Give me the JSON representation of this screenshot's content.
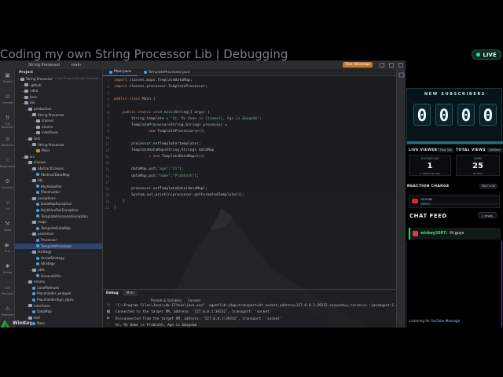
{
  "stream": {
    "title": "Coding my own String Processor Lib | Debugging",
    "live_label": "LIVE",
    "streamer_name": "WinKey"
  },
  "ide": {
    "titlebar": {
      "project": "String Processor",
      "branch": "main",
      "run_config": "TemplateProcessor.java",
      "trial_label": "Trial: Windows"
    },
    "left_strip": [
      {
        "icon": "project-icon",
        "label": "Project"
      },
      {
        "icon": "commit-icon",
        "label": "Commit"
      },
      {
        "icon": "pull-requests-icon",
        "label": "Pull Requests"
      },
      {
        "icon": "structure-icon",
        "label": "Structure"
      },
      {
        "icon": "bookmarks-icon",
        "label": "Bookmarks"
      },
      {
        "icon": "services-icon",
        "label": "Services"
      },
      {
        "icon": "git-icon",
        "label": "Git"
      },
      {
        "icon": "build-icon",
        "label": "Build"
      },
      {
        "icon": "run-icon",
        "label": "Run"
      },
      {
        "icon": "debug-icon",
        "label": "Debug"
      },
      {
        "icon": "terminal-icon",
        "label": "Terminal"
      },
      {
        "icon": "problems-icon",
        "label": "Problems"
      }
    ],
    "project_panel": {
      "header": "Project",
      "tree": [
        {
          "indent": 0,
          "kind": "folder",
          "label": "String Processor",
          "path": "C:\\My Projects\\String Processor"
        },
        {
          "indent": 1,
          "kind": "folder",
          "label": ".github"
        },
        {
          "indent": 1,
          "kind": "folder",
          "label": ".idea"
        },
        {
          "indent": 1,
          "kind": "folder",
          "label": "Java"
        },
        {
          "indent": 1,
          "kind": "folder",
          "label": "bin"
        },
        {
          "indent": 2,
          "kind": "folder",
          "label": "production"
        },
        {
          "indent": 3,
          "kind": "folder",
          "label": "String Processor"
        },
        {
          "indent": 4,
          "kind": "folder",
          "label": "classes"
        },
        {
          "indent": 4,
          "kind": "folder",
          "label": "enums"
        },
        {
          "indent": 4,
          "kind": "folder",
          "label": "interfaces"
        },
        {
          "indent": 2,
          "kind": "folder",
          "label": "test"
        },
        {
          "indent": 3,
          "kind": "folder",
          "label": "String Processor"
        },
        {
          "indent": 4,
          "kind": "file",
          "label": "Main"
        },
        {
          "indent": 1,
          "kind": "folder",
          "label": "src"
        },
        {
          "indent": 2,
          "kind": "folder",
          "label": "classes"
        },
        {
          "indent": 3,
          "kind": "folder",
          "label": "abstractClasses"
        },
        {
          "indent": 4,
          "kind": "class",
          "label": "AbstractDataMap"
        },
        {
          "indent": 3,
          "kind": "folder",
          "label": "dto"
        },
        {
          "indent": 4,
          "kind": "class",
          "label": "KeyValuePair"
        },
        {
          "indent": 4,
          "kind": "class",
          "label": "Placeholder"
        },
        {
          "indent": 3,
          "kind": "folder",
          "label": "exceptions"
        },
        {
          "indent": 4,
          "kind": "class",
          "label": "DataMapException"
        },
        {
          "indent": 4,
          "kind": "class",
          "label": "KeyValuePairException"
        },
        {
          "indent": 4,
          "kind": "class",
          "label": "TemplateProcessorException"
        },
        {
          "indent": 3,
          "kind": "folder",
          "label": "maps"
        },
        {
          "indent": 4,
          "kind": "class",
          "label": "TemplateDataMap"
        },
        {
          "indent": 3,
          "kind": "folder",
          "label": "processor"
        },
        {
          "indent": 4,
          "kind": "class",
          "label": "Processor"
        },
        {
          "indent": 4,
          "kind": "class",
          "label": "TemplateProcessor",
          "selected": true
        },
        {
          "indent": 3,
          "kind": "folder",
          "label": "strategy"
        },
        {
          "indent": 4,
          "kind": "class",
          "label": "ArrowStrategy"
        },
        {
          "indent": 4,
          "kind": "class",
          "label": "Strategy"
        },
        {
          "indent": 3,
          "kind": "folder",
          "label": "utils"
        },
        {
          "indent": 4,
          "kind": "class",
          "label": "GeneralUtils"
        },
        {
          "indent": 2,
          "kind": "folder",
          "label": "enums"
        },
        {
          "indent": 3,
          "kind": "class",
          "label": "CaseMethods"
        },
        {
          "indent": 3,
          "kind": "class",
          "label": "Placeholder_wrapper"
        },
        {
          "indent": 3,
          "kind": "class",
          "label": "PlaceholderSign_signs"
        },
        {
          "indent": 2,
          "kind": "folder",
          "label": "interfaces"
        },
        {
          "indent": 3,
          "kind": "class",
          "label": "DataMap"
        },
        {
          "indent": 2,
          "kind": "folder",
          "label": "test"
        },
        {
          "indent": 3,
          "kind": "class",
          "label": "Main"
        }
      ]
    },
    "editor": {
      "tabs": [
        {
          "label": "Main.java",
          "active": true
        },
        {
          "label": "TemplateProcessor.java",
          "active": false
        }
      ],
      "code": [
        {
          "n": "1",
          "segs": [
            {
              "c": "kw",
              "t": "import "
            },
            {
              "c": "txt",
              "t": "classes.maps.TemplateDataMap;"
            }
          ]
        },
        {
          "n": "2",
          "segs": [
            {
              "c": "kw",
              "t": "import "
            },
            {
              "c": "txt",
              "t": "classes.processor.TemplateProcessor;"
            }
          ]
        },
        {
          "n": "3",
          "segs": []
        },
        {
          "n": "4",
          "segs": [
            {
              "c": "kw",
              "t": "public class "
            },
            {
              "c": "txt",
              "t": "Main {"
            }
          ]
        },
        {
          "n": "5",
          "segs": []
        },
        {
          "n": "6",
          "segs": [
            {
              "c": "kw",
              "t": "    public static void "
            },
            {
              "c": "fn",
              "t": "main"
            },
            {
              "c": "txt",
              "t": "(String[] args) {"
            }
          ]
        },
        {
          "n": "7",
          "segs": [
            {
              "c": "txt",
              "t": "        String template = "
            },
            {
              "c": "str",
              "t": "\"Hi, My Name is {{name}}, Age is &&age&&\""
            },
            {
              "c": "txt",
              "t": ";"
            }
          ]
        },
        {
          "n": "8",
          "segs": [
            {
              "c": "txt",
              "t": "        TemplateProcessor<String,String> processor ="
            }
          ]
        },
        {
          "n": "9",
          "segs": [
            {
              "c": "kw",
              "t": "                new "
            },
            {
              "c": "txt",
              "t": "TemplateProcessor<>();"
            }
          ]
        },
        {
          "n": "10",
          "segs": []
        },
        {
          "n": "11",
          "segs": [
            {
              "c": "txt",
              "t": "        processor.setTemplate(template);"
            }
          ]
        },
        {
          "n": "12",
          "segs": [
            {
              "c": "txt",
              "t": "        TemplateDataMap<String,String> dataMap"
            }
          ]
        },
        {
          "n": "13",
          "segs": [
            {
              "c": "kw",
              "t": "                = new "
            },
            {
              "c": "txt",
              "t": "TemplateDataMap<>();"
            }
          ]
        },
        {
          "n": "14",
          "segs": []
        },
        {
          "n": "15",
          "segs": [
            {
              "c": "txt",
              "t": "        dataMap.put("
            },
            {
              "c": "str",
              "t": "\"age\""
            },
            {
              "c": "txt",
              "t": ","
            },
            {
              "c": "str",
              "t": "\"21\""
            },
            {
              "c": "txt",
              "t": ");"
            }
          ]
        },
        {
          "n": "16",
          "segs": [
            {
              "c": "txt",
              "t": "        dataMap.put("
            },
            {
              "c": "str",
              "t": "\"name\""
            },
            {
              "c": "txt",
              "t": ","
            },
            {
              "c": "str",
              "t": "\"Prabhath\""
            },
            {
              "c": "txt",
              "t": ");"
            }
          ]
        },
        {
          "n": "17",
          "segs": []
        },
        {
          "n": "18",
          "segs": [
            {
              "c": "txt",
              "t": "        processor.setTemplateData(dataMap);"
            }
          ]
        },
        {
          "n": "19",
          "segs": [
            {
              "c": "txt",
              "t": "        System.out.println(processor.getFormatedTemplate());"
            }
          ]
        },
        {
          "n": "20",
          "segs": [
            {
              "c": "txt",
              "t": "    }"
            }
          ]
        },
        {
          "n": "21",
          "segs": [
            {
              "c": "txt",
              "t": "}"
            }
          ]
        }
      ]
    },
    "debug": {
      "label": "Debug",
      "tab": "Main",
      "subtabs": [
        "Threads & Variables",
        "Console"
      ],
      "console": [
        "\"C:\\Program Files\\Java\\jdk-17\\bin\\java.exe\" -agentlib:jdwp=transport=dt_socket,address=127.0.0.1:39232,suspend=y,server=n -javaagent:C:\\Us",
        "Connected to the target VM, address: '127.0.0.1:39232', transport: 'socket'",
        "Disconnected from the target VM, address: '127.0.0.1:39232', transport: 'socket'",
        "Hi, My Name is Prabhath, Age is &&age&&",
        "",
        "Process finished with exit code 0"
      ]
    }
  },
  "overlay": {
    "subscribers": {
      "title": "NEW SUBSCRIBERS",
      "digits": [
        "0",
        "0",
        "0",
        "0"
      ]
    },
    "live_viewers": {
      "label": "LIVE VIEWERS",
      "pill": "Past live",
      "box_label": "YOUTUBE LIVE",
      "value": "1",
      "sub": "1 watching now"
    },
    "total_views": {
      "label": "TOTAL VIEWS",
      "pill": "Lifetime",
      "box_label": "VIEWS",
      "value": "25",
      "sub": "all time"
    },
    "reaction": {
      "label": "REACTION CHARGE",
      "pill": "Poll+chat",
      "box_label": "YOUTUBE",
      "level": 0.12
    },
    "chat": {
      "title": "CHAT FEED",
      "msgs_pill": "1 msgs",
      "messages": [
        {
          "user": "winkey2007:",
          "text": "Hi guys"
        }
      ],
      "listening_prefix": "Listening for ",
      "listening_source": "YouTube.Message"
    }
  },
  "colors": {
    "accent_green": "#2ee38c",
    "subs_teal": "#175a67",
    "chat_user": "#3be08d",
    "ide_bg": "#1e1f22"
  }
}
